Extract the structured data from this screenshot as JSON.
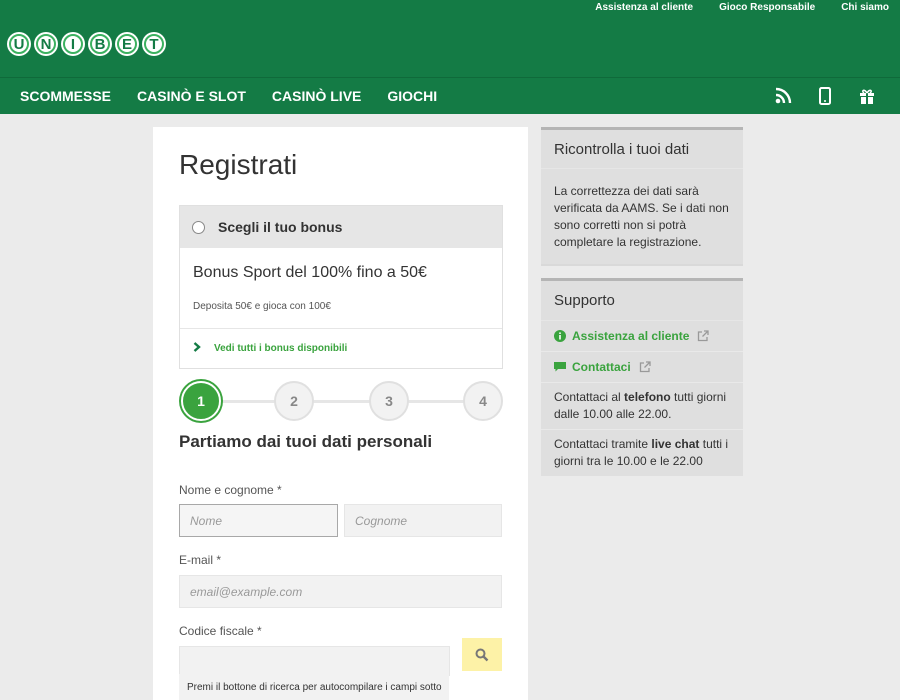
{
  "header": {
    "top_links": [
      "Assistenza al cliente",
      "Gioco Responsabile",
      "Chi siamo"
    ],
    "logo_letters": [
      "U",
      "N",
      "I",
      "B",
      "E",
      "T"
    ],
    "nav": [
      "SCOMMESSE",
      "CASINÒ E SLOT",
      "CASINÒ LIVE",
      "GIOCHI"
    ],
    "nav_icons": [
      "rss-icon",
      "mobile-icon",
      "gift-icon"
    ]
  },
  "form": {
    "title": "Registrati",
    "bonus": {
      "header": "Scegli il tuo bonus",
      "name": "Bonus Sport del 100% fino a 50€",
      "description": "Deposita 50€ e gioca con 100€",
      "all_link": "Vedi tutti i bonus disponibili"
    },
    "steps": [
      "1",
      "2",
      "3",
      "4"
    ],
    "active_step": 1,
    "section_title": "Partiamo dai tuoi dati personali",
    "name_label": "Nome e cognome *",
    "first_name_placeholder": "Nome",
    "last_name_placeholder": "Cognome",
    "email_label": "E-mail *",
    "email_placeholder": "email@example.com",
    "cf_label": "Codice fiscale *",
    "cf_hint": "Premi il bottone di ricerca per autocompilare i campi sotto"
  },
  "sidebar": {
    "check": {
      "title": "Ricontrolla i tuoi dati",
      "body": "La correttezza dei dati sarà verificata da AAMS. Se i dati non sono corretti non si potrà completare la registrazione."
    },
    "support": {
      "title": "Supporto",
      "help_link": "Assistenza al cliente",
      "contact_link": "Contattaci",
      "phone_pre": "Contattaci al ",
      "phone_bold": "telefono",
      "phone_post": " tutti giorni dalle 10.00 alle 22.00.",
      "chat_pre": "Contattaci tramite ",
      "chat_bold": "live chat",
      "chat_post": " tutti i giorni tra le 10.00 e le 22.00"
    }
  },
  "colors": {
    "brand": "#147b45",
    "accent": "#3aa33e",
    "search_button": "#fdf2a7"
  }
}
